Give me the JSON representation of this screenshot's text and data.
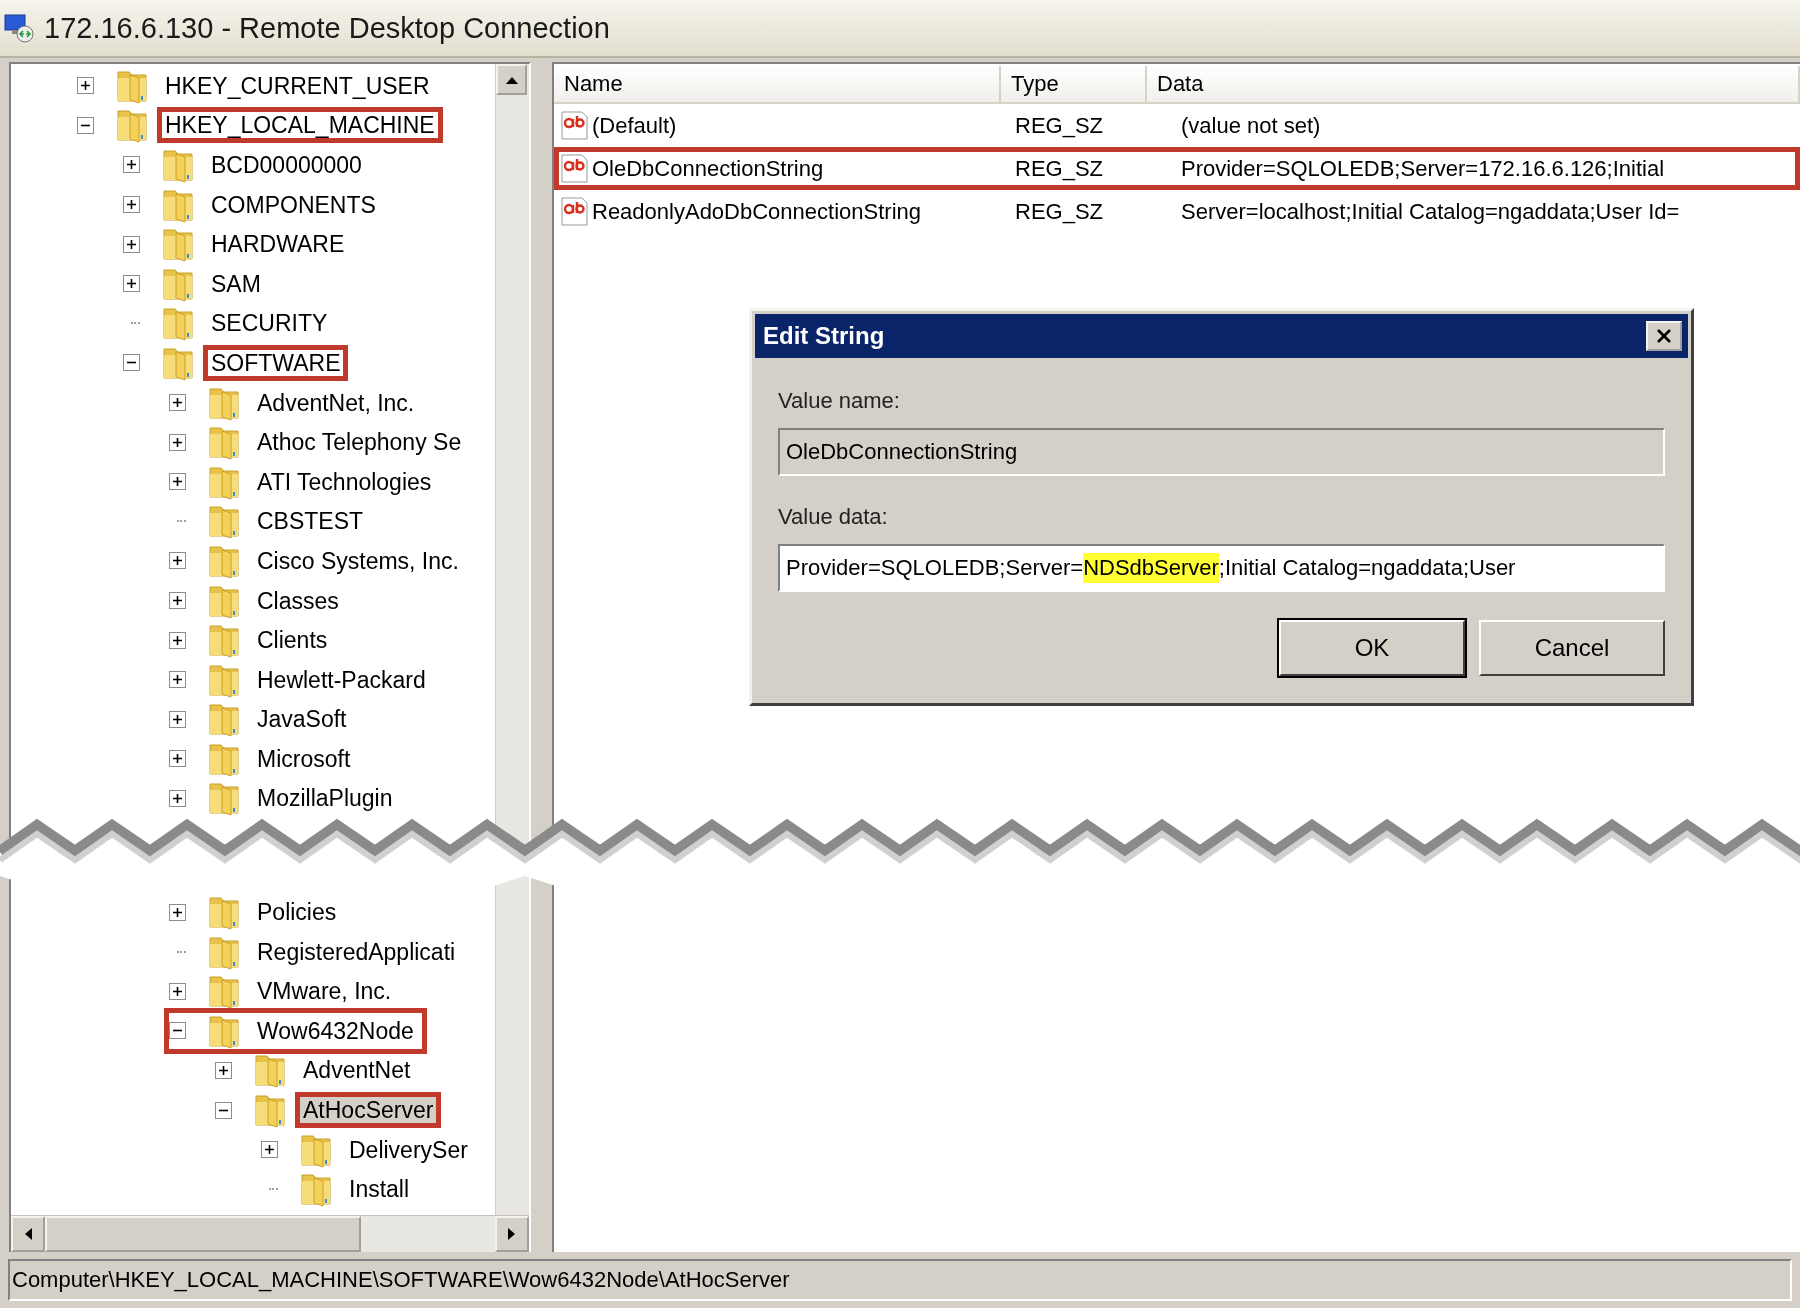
{
  "window": {
    "title": "172.16.6.130 - Remote Desktop Connection"
  },
  "tree": {
    "items": [
      {
        "label": "HKEY_CURRENT_USER",
        "kind": "branch",
        "expanded": false,
        "selected": false,
        "annotated": false
      },
      {
        "label": "HKEY_LOCAL_MACHINE",
        "kind": "branch",
        "expanded": true,
        "selected": false,
        "annotated": true,
        "annotation_wide": false,
        "children": [
          {
            "label": "BCD00000000",
            "kind": "branch",
            "expanded": false,
            "selected": false,
            "annotated": false
          },
          {
            "label": "COMPONENTS",
            "kind": "branch",
            "expanded": false,
            "selected": false,
            "annotated": false
          },
          {
            "label": "HARDWARE",
            "kind": "branch",
            "expanded": false,
            "selected": false,
            "annotated": false
          },
          {
            "label": "SAM",
            "kind": "branch",
            "expanded": false,
            "selected": false,
            "annotated": false
          },
          {
            "label": "SECURITY",
            "kind": "leaf",
            "selected": false,
            "annotated": false
          },
          {
            "label": "SOFTWARE",
            "kind": "branch",
            "expanded": true,
            "selected": false,
            "annotated": true,
            "annotation_wide": false,
            "children": [
              {
                "label": "AdventNet, Inc.",
                "kind": "branch",
                "expanded": false,
                "selected": false,
                "annotated": false
              },
              {
                "label": "Athoc Telephony Se",
                "kind": "branch",
                "expanded": false,
                "selected": false,
                "annotated": false
              },
              {
                "label": "ATI Technologies",
                "kind": "branch",
                "expanded": false,
                "selected": false,
                "annotated": false
              },
              {
                "label": "CBSTEST",
                "kind": "leaf",
                "selected": false,
                "annotated": false
              },
              {
                "label": "Cisco Systems, Inc.",
                "kind": "branch",
                "expanded": false,
                "selected": false,
                "annotated": false
              },
              {
                "label": "Classes",
                "kind": "branch",
                "expanded": false,
                "selected": false,
                "annotated": false
              },
              {
                "label": "Clients",
                "kind": "branch",
                "expanded": false,
                "selected": false,
                "annotated": false
              },
              {
                "label": "Hewlett-Packard",
                "kind": "branch",
                "expanded": false,
                "selected": false,
                "annotated": false
              },
              {
                "label": "JavaSoft",
                "kind": "branch",
                "expanded": false,
                "selected": false,
                "annotated": false
              },
              {
                "label": "Microsoft",
                "kind": "branch",
                "expanded": false,
                "selected": false,
                "annotated": false
              },
              {
                "label": "MozillaPlugin",
                "kind": "branch",
                "expanded": false,
                "selected": false,
                "annotated": false
              },
              {
                "kind": "tear"
              },
              {
                "label": "Policies",
                "kind": "branch",
                "expanded": false,
                "selected": false,
                "annotated": false
              },
              {
                "label": "RegisteredApplicati",
                "kind": "leaf",
                "selected": false,
                "annotated": false
              },
              {
                "label": "VMware, Inc.",
                "kind": "branch",
                "expanded": false,
                "selected": false,
                "annotated": false
              },
              {
                "label": "Wow6432Node",
                "kind": "branch",
                "expanded": true,
                "selected": false,
                "annotated": true,
                "annotation_wide": true,
                "children": [
                  {
                    "label": "AdventNet",
                    "kind": "branch",
                    "expanded": false,
                    "selected": false,
                    "annotated": false
                  },
                  {
                    "label": "AtHocServer",
                    "kind": "branch",
                    "expanded": true,
                    "selected": true,
                    "annotated": true,
                    "annotation_wide": false,
                    "children": [
                      {
                        "label": "DeliverySer",
                        "kind": "branch",
                        "expanded": false,
                        "selected": false,
                        "annotated": false
                      },
                      {
                        "label": "Install",
                        "kind": "leaf",
                        "selected": false,
                        "annotated": false
                      }
                    ]
                  }
                ]
              }
            ]
          }
        ]
      }
    ]
  },
  "values_list": {
    "columns": [
      "Name",
      "Type",
      "Data"
    ],
    "rows": [
      {
        "name": "(Default)",
        "type": "REG_SZ",
        "data": "(value not set)",
        "annotated": false
      },
      {
        "name": "OleDbConnectionString",
        "type": "REG_SZ",
        "data": "Provider=SQLOLEDB;Server=172.16.6.126;Initial",
        "annotated": true
      },
      {
        "name": "ReadonlyAdoDbConnectionString",
        "type": "REG_SZ",
        "data": "Server=localhost;Initial Catalog=ngaddata;User Id=",
        "annotated": false
      }
    ]
  },
  "dialog": {
    "title": "Edit String",
    "value_name_label": "Value name:",
    "value_name": "OleDbConnectionString",
    "value_data_label": "Value data:",
    "value_data": [
      {
        "text": "Provider=SQLOLEDB;Server=",
        "highlighted": false
      },
      {
        "text": "NDSdbServer",
        "highlighted": true
      },
      {
        "text": ";Initial Catalog=ngaddata;User",
        "highlighted": false
      }
    ],
    "buttons": [
      {
        "label": "OK",
        "default": true
      },
      {
        "label": "Cancel",
        "default": false
      }
    ]
  },
  "status_bar": "Computer\\HKEY_LOCAL_MACHINE\\SOFTWARE\\Wow6432Node\\AtHocServer"
}
